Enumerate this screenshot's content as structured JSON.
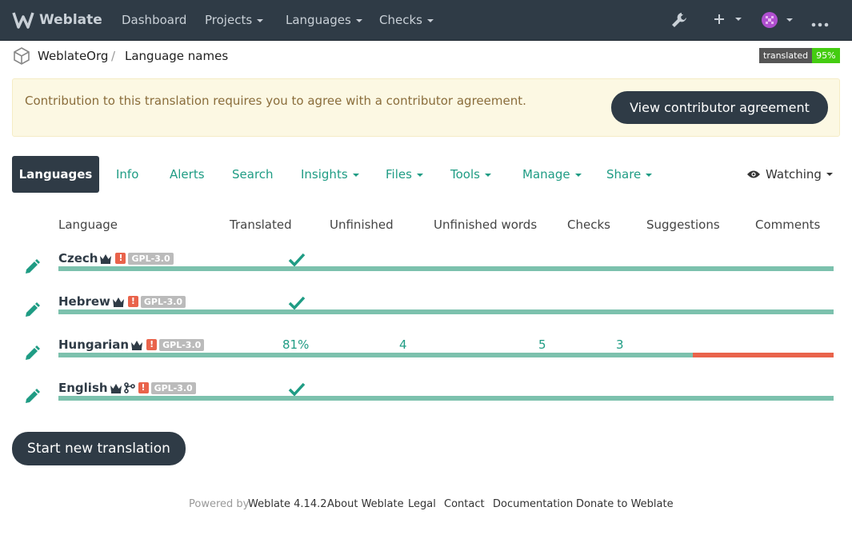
{
  "navbar": {
    "brand": "Weblate",
    "items": [
      {
        "label": "Dashboard",
        "dropdown": false
      },
      {
        "label": "Projects",
        "dropdown": true
      },
      {
        "label": "Languages",
        "dropdown": true
      },
      {
        "label": "Checks",
        "dropdown": true
      }
    ],
    "icons": [
      "wrench-icon",
      "plus-icon",
      "avatar",
      "more-icon"
    ]
  },
  "breadcrumb": {
    "organization": "WeblateOrg",
    "separator": "/",
    "project": "Language names"
  },
  "badge": {
    "label": "translated",
    "value": "95%"
  },
  "alert": {
    "text": "Contribution to this translation requires you to agree with a contributor agreement.",
    "button": "View contributor agreement"
  },
  "tabs": [
    {
      "label": "Languages",
      "active": true,
      "dropdown": false
    },
    {
      "label": "Info",
      "active": false,
      "dropdown": false
    },
    {
      "label": "Alerts",
      "active": false,
      "dropdown": false
    },
    {
      "label": "Search",
      "active": false,
      "dropdown": false
    },
    {
      "label": "Insights",
      "active": false,
      "dropdown": true
    },
    {
      "label": "Files",
      "active": false,
      "dropdown": true
    },
    {
      "label": "Tools",
      "active": false,
      "dropdown": true
    },
    {
      "label": "Manage",
      "active": false,
      "dropdown": true
    },
    {
      "label": "Share",
      "active": false,
      "dropdown": true
    }
  ],
  "watch": {
    "label": "Watching"
  },
  "table": {
    "headers": [
      "Language",
      "Translated",
      "Unfinished",
      "Unfinished words",
      "Checks",
      "Suggestions",
      "Comments"
    ],
    "rows": [
      {
        "name": "Czech",
        "license": "GPL-3.0",
        "error": "!",
        "translated": "",
        "complete": true,
        "unfinished": "",
        "unfinished_words": "",
        "checks": "",
        "progress": 1.0
      },
      {
        "name": "Hebrew",
        "license": "GPL-3.0",
        "error": "!",
        "translated": "",
        "complete": true,
        "unfinished": "",
        "unfinished_words": "",
        "checks": "",
        "progress": 1.0
      },
      {
        "name": "Hungarian",
        "license": "GPL-3.0",
        "error": "!",
        "translated": "81%",
        "complete": false,
        "unfinished": "4",
        "unfinished_words": "5",
        "checks": "3",
        "progress": 0.818
      },
      {
        "name": "English",
        "license": "GPL-3.0",
        "error": "!",
        "translated": "",
        "complete": true,
        "unfinished": "",
        "unfinished_words": "",
        "checks": "",
        "progress": 1.0,
        "source": true
      }
    ]
  },
  "start_button": "Start new translation",
  "footer": {
    "powered_by": "Powered by",
    "version": "Weblate 4.14.2",
    "links": [
      "About Weblate",
      "Legal",
      "Contact",
      "Documentation",
      "Donate to Weblate"
    ]
  },
  "colors": {
    "navbar": "#2f3b46",
    "accent": "#1f9c84",
    "progress_done": "#7cc1ad",
    "progress_missing": "#e9634b",
    "alert_bg": "#fcf8e3"
  }
}
